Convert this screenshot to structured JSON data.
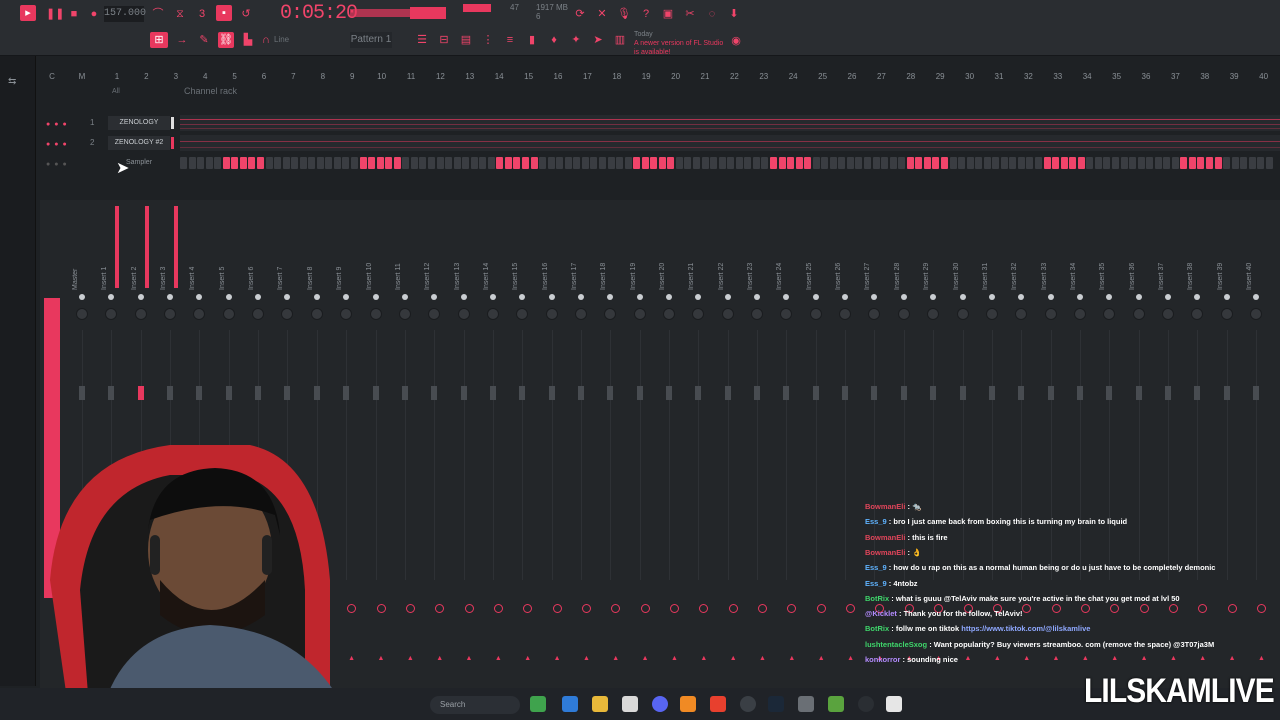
{
  "toolbar": {
    "tempo": "157.000",
    "clock": "0:05:20",
    "cpu_value": "47",
    "memory": "1917 MB",
    "memory_sub": "6",
    "pattern": "Pattern 1",
    "line_mode": "Line",
    "update_title": "Today",
    "update_text": "A newer version of FL Studio is available!"
  },
  "rack": {
    "title": "Channel rack",
    "filter": "All",
    "channels": [
      {
        "num": "1",
        "name": "ZENOLOGY"
      },
      {
        "num": "2",
        "name": "ZENOLOGY #2"
      },
      {
        "num": "",
        "name": "Sampler"
      }
    ]
  },
  "ruler": {
    "numbers": [
      "C",
      "M",
      "1",
      "2",
      "3",
      "4",
      "5",
      "6",
      "7",
      "8",
      "9",
      "10",
      "11",
      "12",
      "13",
      "14",
      "15",
      "16",
      "17",
      "18",
      "19",
      "20",
      "21",
      "22",
      "23",
      "24",
      "25",
      "26",
      "27",
      "28",
      "29",
      "30",
      "31",
      "32",
      "33",
      "34",
      "35",
      "36",
      "37",
      "38",
      "39",
      "40"
    ]
  },
  "mixer": {
    "strips": [
      "Master",
      "Insert 1",
      "Insert 2",
      "Insert 3",
      "Insert 4",
      "Insert 5",
      "Insert 6",
      "Insert 7",
      "Insert 8",
      "Insert 9",
      "Insert 10",
      "Insert 11",
      "Insert 12",
      "Insert 13",
      "Insert 14",
      "Insert 15",
      "Insert 16",
      "Insert 17",
      "Insert 18",
      "Insert 19",
      "Insert 20",
      "Insert 21",
      "Insert 22",
      "Insert 23",
      "Insert 24",
      "Insert 25",
      "Insert 26",
      "Insert 27",
      "Insert 28",
      "Insert 29",
      "Insert 30",
      "Insert 31",
      "Insert 32",
      "Insert 33",
      "Insert 34",
      "Insert 35",
      "Insert 36",
      "Insert 37",
      "Insert 38",
      "Insert 39",
      "Insert 40"
    ]
  },
  "taskbar": {
    "search": "Search"
  },
  "chat": [
    {
      "user": "BowmanEli",
      "user_color": "#e0455a",
      "msg": "🐀",
      "link": ""
    },
    {
      "user": "Ess_9",
      "user_color": "#5fb3ff",
      "msg": "bro I just came back from boxing this is turning my brain to liquid",
      "link": ""
    },
    {
      "user": "BowmanEli",
      "user_color": "#e0455a",
      "msg": "this is fire",
      "link": ""
    },
    {
      "user": "BowmanEli",
      "user_color": "#e0455a",
      "msg": "👌",
      "link": ""
    },
    {
      "user": "Ess_9",
      "user_color": "#5fb3ff",
      "msg": "how do u rap on this as a normal human being or do u just have to be completely demonic",
      "link": ""
    },
    {
      "user": "Ess_9",
      "user_color": "#5fb3ff",
      "msg": "4ntobz",
      "link": ""
    },
    {
      "user": "BotRix",
      "user_color": "#3fd66b",
      "msg": "what is guuu @TelAviv make sure you're active in the chat you get mod at lvl 50",
      "link": ""
    },
    {
      "user": "@Kicklet",
      "user_color": "#b48cff",
      "msg": "Thank you for the follow, TelAviv!",
      "link": ""
    },
    {
      "user": "BotRix",
      "user_color": "#3fd66b",
      "msg": "follw me on tiktok",
      "link": "https://www.tiktok.com/@lilskamlive"
    },
    {
      "user": "lushtentacleSxog",
      "user_color": "#3fd66b",
      "msg": "Want popularity? Buy viewers streamboo. com (remove the space) @3T07ja3M",
      "link": ""
    },
    {
      "user": "konkorror",
      "user_color": "#b48cff",
      "msg": "sounding nice",
      "link": ""
    }
  ],
  "brand": "LILSKAMLIVE",
  "colors": {
    "accent": "#e8385e",
    "background": "#1e2124"
  }
}
